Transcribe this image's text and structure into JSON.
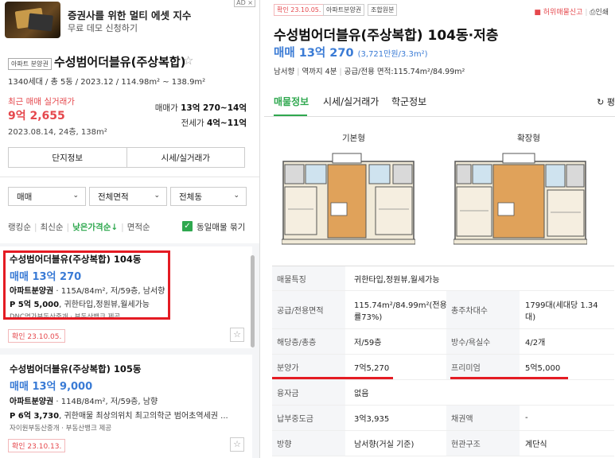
{
  "ad": {
    "title": "증권사를 위한 멀티 에셋 지수",
    "subtitle": "무료 데모 신청하기",
    "badge": "AD ×"
  },
  "complex": {
    "tag": "아파트 분양권",
    "name": "수성범어더블유(주상복합)",
    "meta": "1340세대 / 총 5동 / 2023.12 / 114.98m² ~ 138.9m²",
    "recent_label": "최근 매매 실거래가",
    "recent_price": "9억 2,655",
    "recent_date": "2023.08.14, 24층, 138m²",
    "sale_label": "매매가",
    "sale_range": "13억 270~14억",
    "jeonse_label": "전세가",
    "jeonse_range": "4억~11억",
    "btn_info": "단지정보",
    "btn_price": "시세/실거래가"
  },
  "filters": {
    "trade": "매매",
    "area": "전체면적",
    "building": "전체동"
  },
  "sort": {
    "ranking": "랭킹순",
    "latest": "최신순",
    "low_price": "낮은가격순↓",
    "area": "면적순",
    "bundle_label": "동일매물 묶기"
  },
  "listings": [
    {
      "title": "수성범어더블유(주상복합) 104동",
      "price": "매매 13억 270",
      "spec_type": "아파트분양권",
      "spec_rest": " · 115A/84m², 저/59층, 남서향",
      "desc_head": "P 5억 5,000",
      "desc_rest": ", 귀한타입,정원뷰,월세가능",
      "source": "DNC명가부동산중개 · 부동산뱅크 제공",
      "confirm": "확인 23.10.05."
    },
    {
      "title": "수성범어더블유(주상복합) 105동",
      "price": "매매 13억 9,000",
      "spec_type": "아파트분양권",
      "spec_rest": " · 114B/84m², 저/59층, 남향",
      "desc_head": "P 6억 3,730",
      "desc_rest": ", 귀한매물 최상의위치 최고의학군 범어초역세권 ...",
      "source": "자이원부동산중개 · 부동산뱅크 제공",
      "confirm": "확인 23.10.13."
    }
  ],
  "detail": {
    "tag_confirm": "확인 23.10.05.",
    "tag_type": "아파트분양권",
    "tag_assoc": "조합원분",
    "report": "허위매물신고",
    "print": "인쇄",
    "title": "수성범어더블유(주상복합) 104동·저층",
    "price": "매매 13억 270",
    "price_unit": "(3,721만원/3.3m²)",
    "meta_dir": "남서향",
    "meta_station": "역까지 4분",
    "meta_area": "공급/전용 면적:115.74m²/84.99m²",
    "tabs": [
      "매물정보",
      "시세/실거래가",
      "학군정보"
    ],
    "refresh": "평",
    "floorplan_basic": "기본형",
    "floorplan_ext": "확장형",
    "table": {
      "feature_label": "매물특징",
      "feature_value": "귀한타입,정원뷰,월세가능",
      "area_label": "공급/전용면적",
      "area_value_1": "115.74m²/84.99m²(전용",
      "area_value_2": "률73%)",
      "households_label": "총주차대수",
      "households_value_1": "1799대(세대당 1.34",
      "households_value_2": "대)",
      "floor_label": "해당층/총층",
      "floor_value": "저/59층",
      "rooms_label": "방수/욕실수",
      "rooms_value": "4/2개",
      "presale_label": "분양가",
      "presale_value": "7억5,270",
      "premium_label": "프리미엄",
      "premium_value": "5억5,000",
      "loan_label": "융자금",
      "loan_value": "없음",
      "paid_label": "납부중도금",
      "paid_value": "3억3,935",
      "bond_label": "채권액",
      "bond_value": "-",
      "direction_label": "방향",
      "direction_value": "남서향(거실 기준)",
      "entrance_label": "현관구조",
      "entrance_value": "계단식"
    }
  }
}
